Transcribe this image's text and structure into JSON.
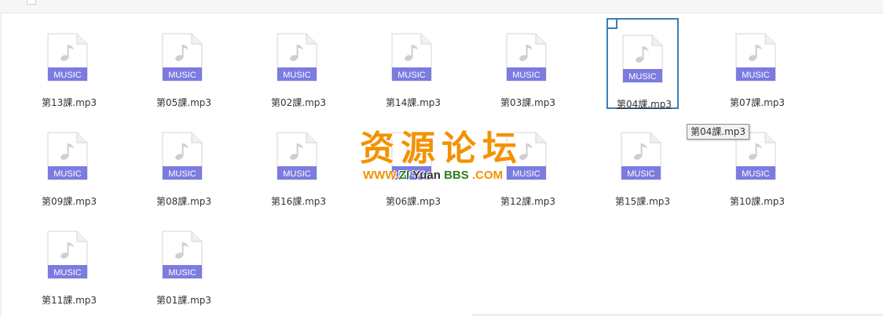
{
  "files": [
    {
      "name": "第13課.mp3"
    },
    {
      "name": "第05課.mp3"
    },
    {
      "name": "第02課.mp3"
    },
    {
      "name": "第14課.mp3"
    },
    {
      "name": "第03課.mp3"
    },
    {
      "name": "第04課.mp3",
      "selected": true
    },
    {
      "name": "第07課.mp3"
    },
    {
      "name": "第09課.mp3"
    },
    {
      "name": "第08課.mp3"
    },
    {
      "name": "第16課.mp3"
    },
    {
      "name": "第06課.mp3"
    },
    {
      "name": "第12課.mp3"
    },
    {
      "name": "第15課.mp3"
    },
    {
      "name": "第10課.mp3"
    },
    {
      "name": "第11課.mp3"
    },
    {
      "name": "第01課.mp3"
    }
  ],
  "icon_label": "MUSIC",
  "tooltip": "第04課.mp3",
  "watermark": {
    "title": "资源论坛",
    "url_part1": "WWW.",
    "url_part2": "ZI",
    "url_part3": " Yuan ",
    "url_part4": "BBS",
    "url_part5": " .COM"
  },
  "colors": {
    "icon_band": "#7b7be0",
    "selection": "#3a7fb7",
    "watermark_orange": "#f39200",
    "watermark_green": "#2e7d1f"
  }
}
